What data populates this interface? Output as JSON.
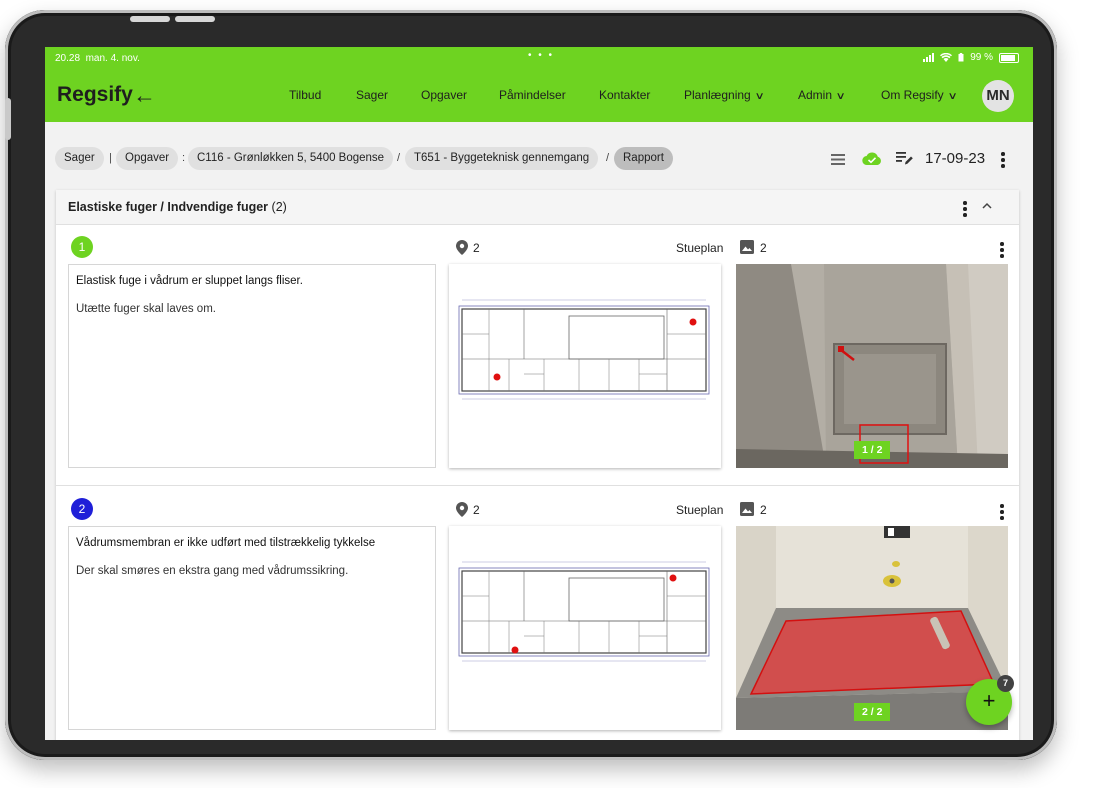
{
  "status": {
    "time": "20.28",
    "date": "man. 4. nov.",
    "dots": "• • •",
    "battery": "99 %"
  },
  "app": {
    "logo": "Regsify",
    "back_icon": "arrow-left-icon",
    "brand_color": "#6ed321",
    "avatar": "MN"
  },
  "nav": [
    {
      "label": "Tilbud",
      "dropdown": false
    },
    {
      "label": "Sager",
      "dropdown": false
    },
    {
      "label": "Opgaver",
      "dropdown": false
    },
    {
      "label": "Påmindelser",
      "dropdown": false
    },
    {
      "label": "Kontakter",
      "dropdown": false
    },
    {
      "label": "Planlægning",
      "dropdown": true
    },
    {
      "label": "Admin",
      "dropdown": true
    },
    {
      "label": "Om Regsify",
      "dropdown": true
    }
  ],
  "breadcrumb": {
    "sager": "Sager",
    "pipe": "|",
    "opgaver": "Opgaver",
    "colon": ":",
    "case": "C116 - Grønløkken 5, 5400 Bogense",
    "slash": "/",
    "task": "T651 - Byggeteknisk gennemgang",
    "report": "Rapport"
  },
  "toolbar": {
    "date": "17-09-23",
    "icons": [
      "list-icon",
      "cloud-done-icon",
      "edit-list-icon",
      "more-vert-icon"
    ]
  },
  "section": {
    "title": "Elastiske fuger / Indvendige fuger",
    "count": "(2)"
  },
  "items": [
    {
      "number": "1",
      "number_color": "#6ed321",
      "title": "Elastisk fuge i vådrum er sluppet langs fliser.",
      "description": "Utætte fuger skal laves om.",
      "pin_count": "2",
      "plan_name": "Stueplan",
      "image_count": "2",
      "image_badge": "1 / 2"
    },
    {
      "number": "2",
      "number_color": "#1f1fd8",
      "title": "Vådrumsmembran er ikke udført med tilstrækkelig tykkelse",
      "description": "Der skal smøres en ekstra gang med vådrumssikring.",
      "pin_count": "2",
      "plan_name": "Stueplan",
      "image_count": "2",
      "image_badge": "2 / 2"
    }
  ],
  "fab": {
    "label": "+",
    "badge": "7"
  }
}
